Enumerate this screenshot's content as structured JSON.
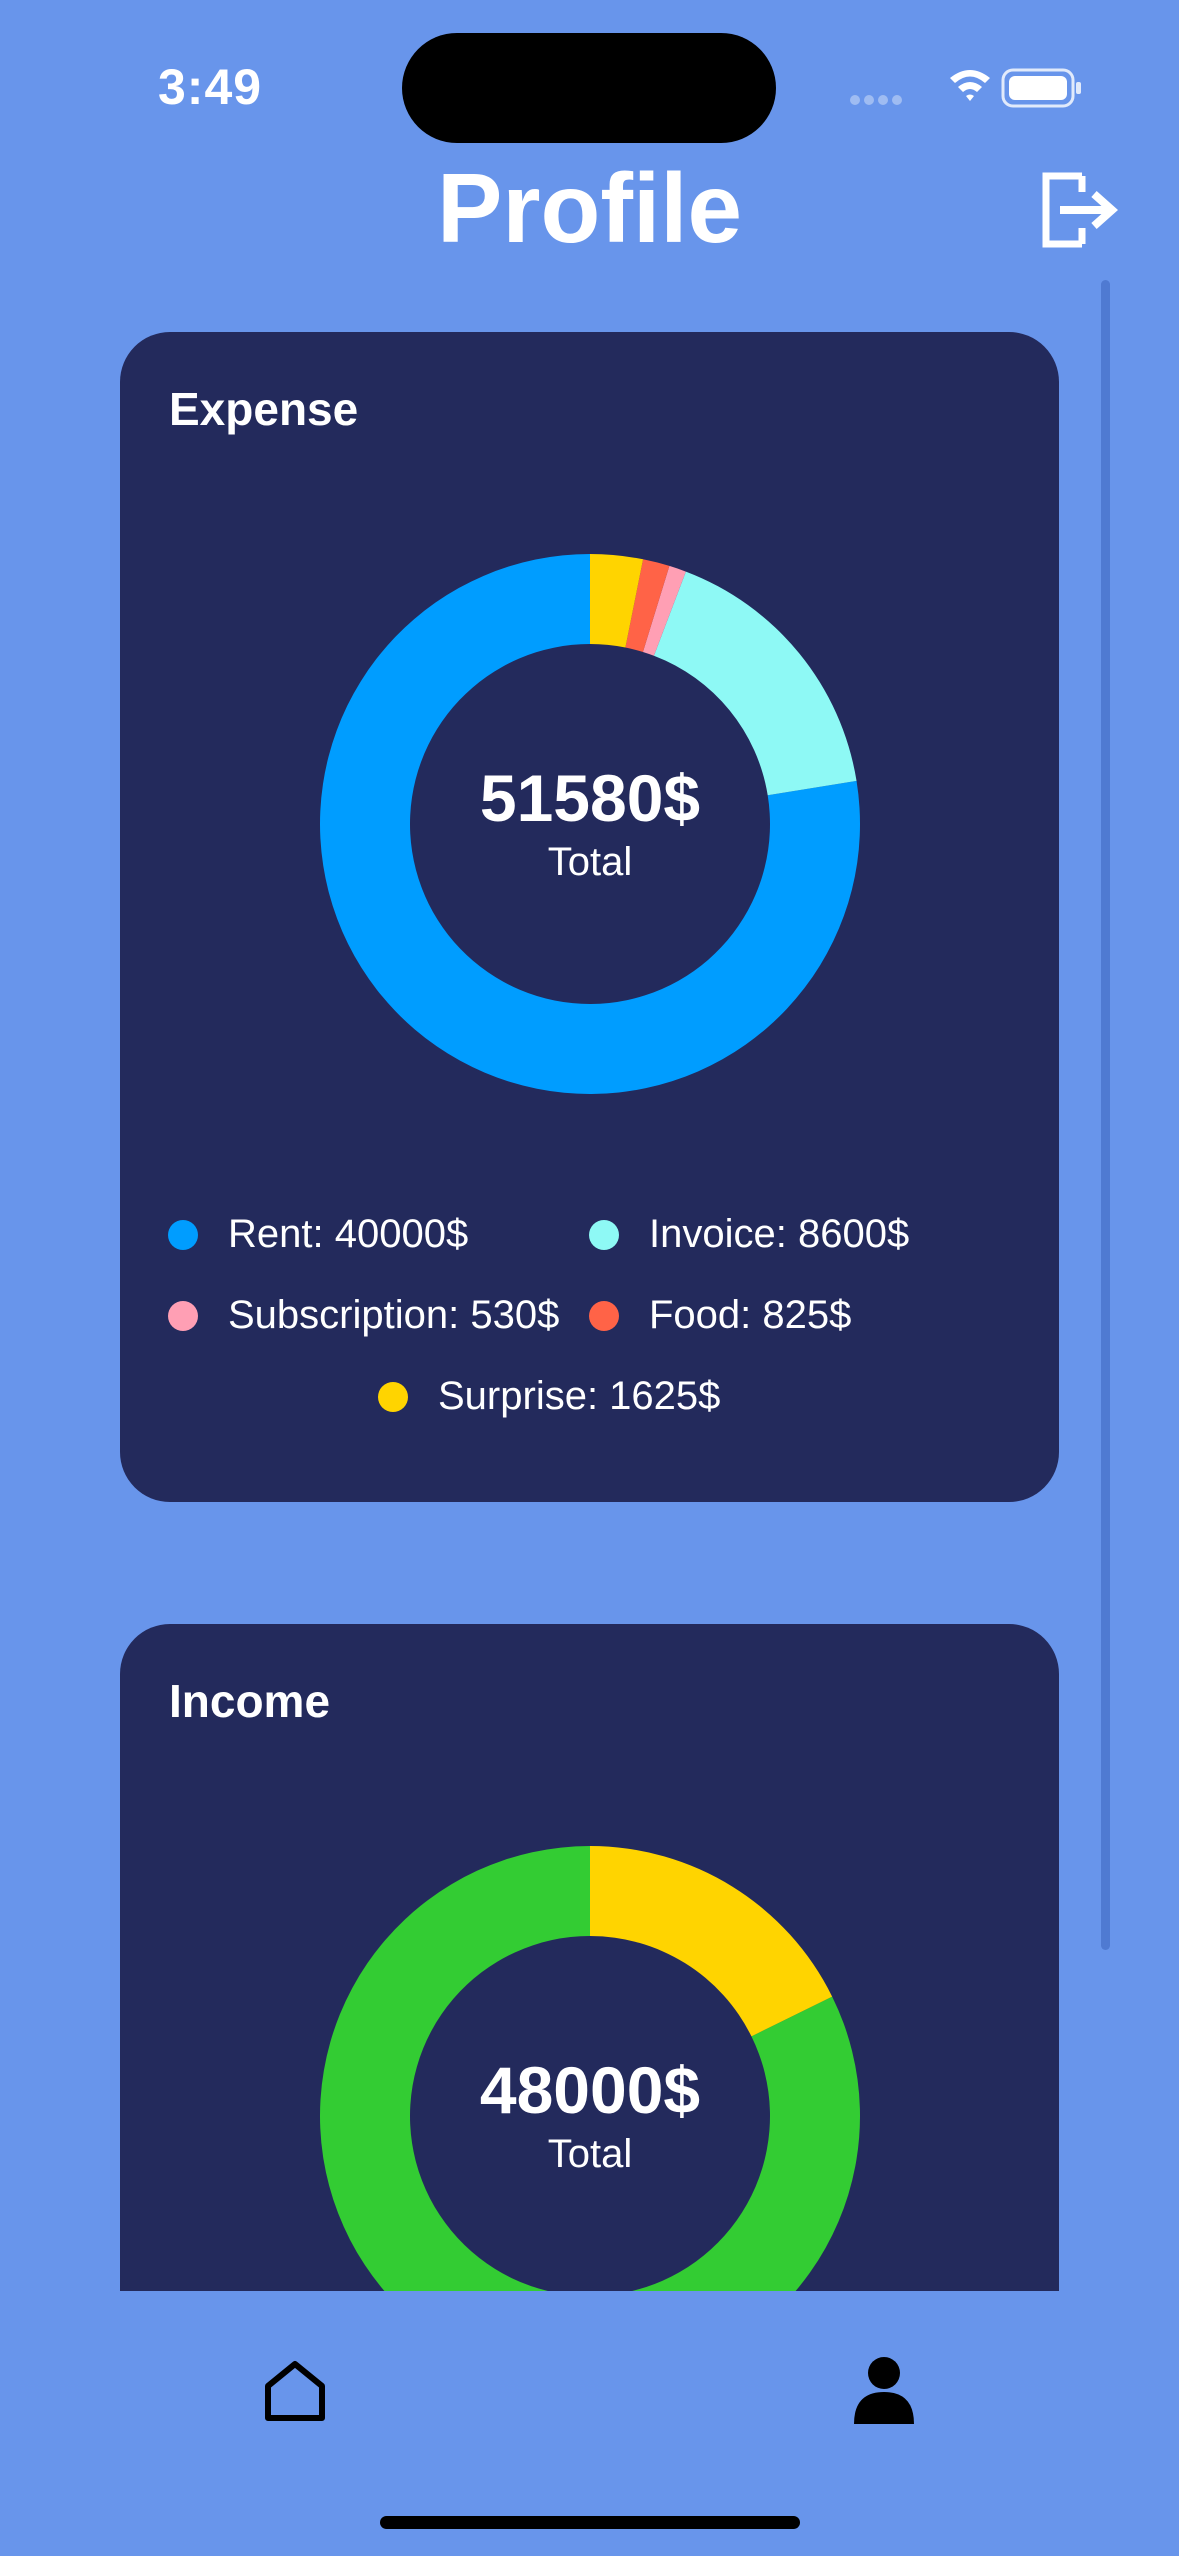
{
  "status": {
    "time": "3:49"
  },
  "header": {
    "title": "Profile"
  },
  "expense": {
    "title": "Expense",
    "total": "51580$",
    "total_label": "Total",
    "legend": [
      {
        "text": "Rent: 40000$",
        "color": "#009dff"
      },
      {
        "text": "Invoice: 8600$",
        "color": "#8ef9f5"
      },
      {
        "text": "Subscription: 530$",
        "color": "#ff9fb4"
      },
      {
        "text": "Food: 825$",
        "color": "#ff6347"
      },
      {
        "text": "Surprise: 1625$",
        "color": "#ffd400"
      }
    ]
  },
  "income": {
    "title": "Income",
    "total": "48000$",
    "total_label": "Total"
  },
  "chart_data": [
    {
      "type": "pie",
      "title": "Expense",
      "categories": [
        "Rent",
        "Invoice",
        "Subscription",
        "Food",
        "Surprise"
      ],
      "values": [
        40000,
        8600,
        530,
        825,
        1625
      ],
      "colors": [
        "#009dff",
        "#8ef9f5",
        "#ff9fb4",
        "#ff6347",
        "#ffd400"
      ],
      "center_label": "51580$"
    },
    {
      "type": "pie",
      "title": "Income",
      "categories": [
        "",
        ""
      ],
      "values": [
        39500,
        8500
      ],
      "colors": [
        "#33cc33",
        "#ffd400"
      ],
      "center_label": "48000$"
    }
  ]
}
